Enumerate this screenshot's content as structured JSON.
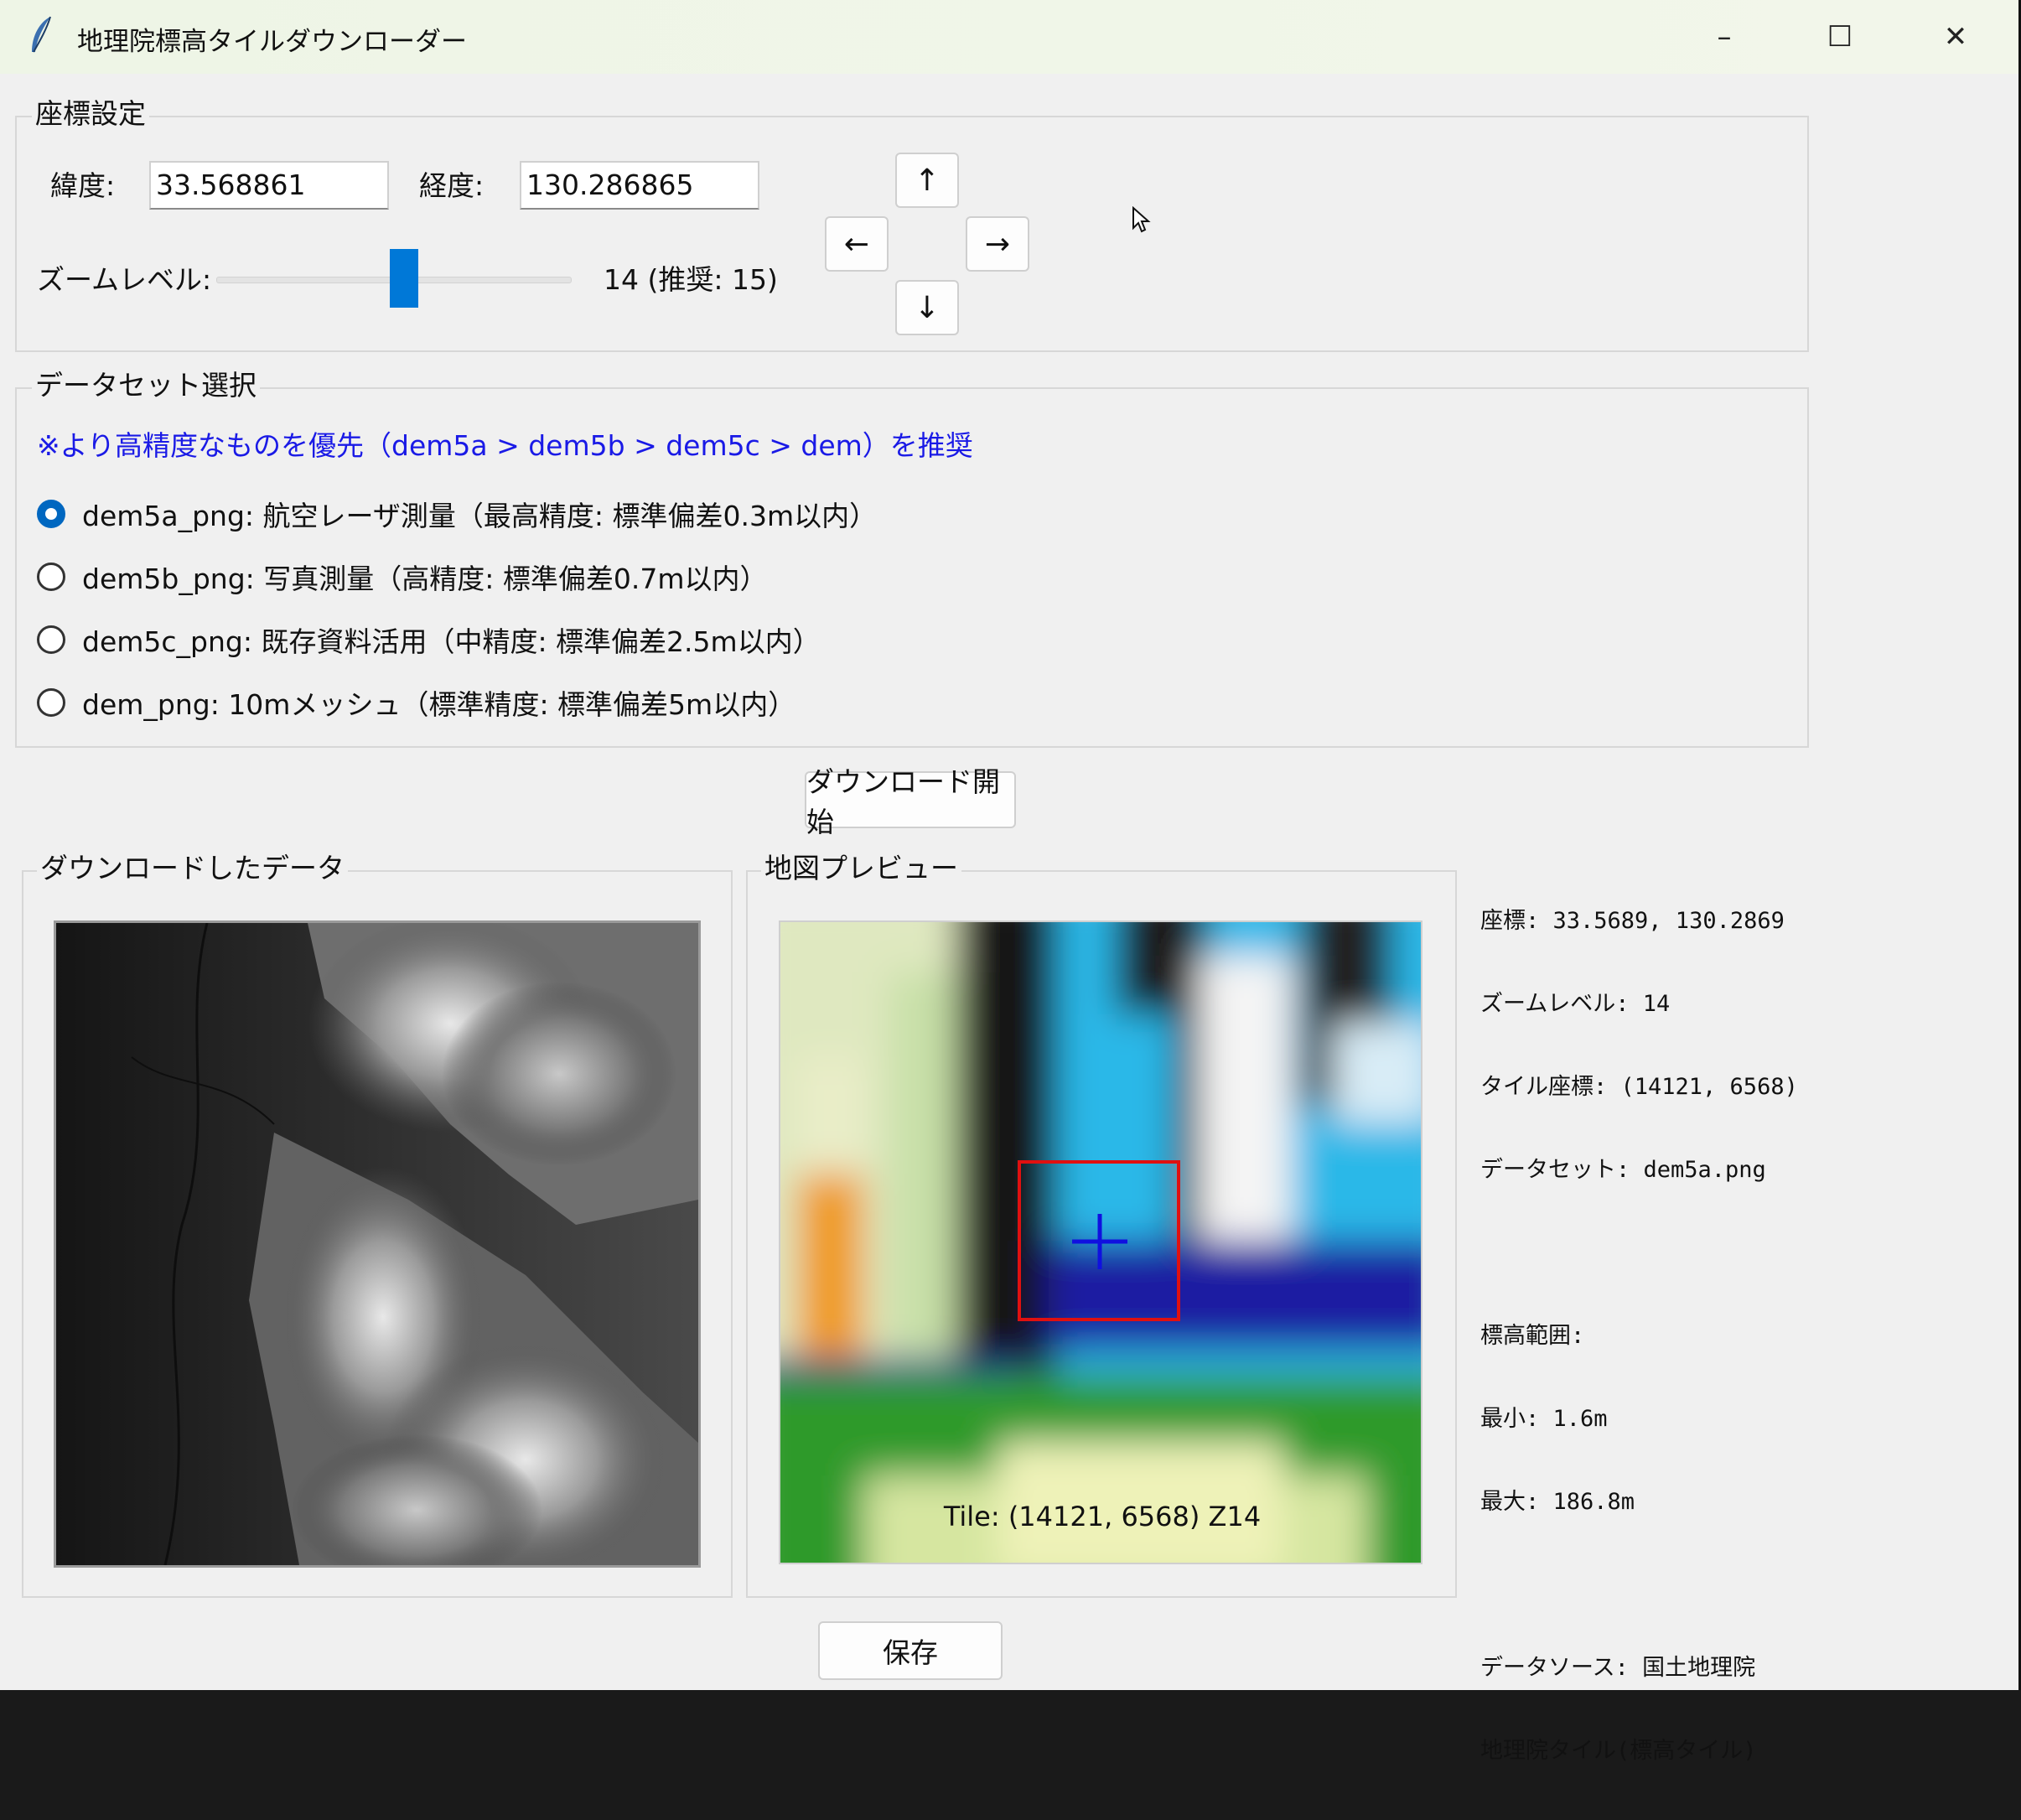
{
  "window": {
    "title": "地理院標高タイルダウンローダー",
    "controls": {
      "minimize": "–",
      "maximize": "☐",
      "close": "✕"
    }
  },
  "coords": {
    "group_label": "座標設定",
    "lat_label": "緯度:",
    "lat_value": "33.568861",
    "lon_label": "経度:",
    "lon_value": "130.286865",
    "zoom_label": "ズームレベル:",
    "zoom_value_text": "14 (推奨: 15)",
    "zoom_level": 14,
    "arrows": {
      "up": "↑",
      "left": "←",
      "right": "→",
      "down": "↓"
    }
  },
  "dataset": {
    "group_label": "データセット選択",
    "note": "※より高精度なものを優先（dem5a > dem5b > dem5c > dem）を推奨",
    "note_color": "#1a1ae6",
    "options": [
      {
        "label": "dem5a_png: 航空レーザ測量（最高精度: 標準偏差0.3m以内）",
        "selected": true
      },
      {
        "label": "dem5b_png: 写真測量（高精度: 標準偏差0.7m以内）",
        "selected": false
      },
      {
        "label": "dem5c_png: 既存資料活用（中精度: 標準偏差2.5m以内）",
        "selected": false
      },
      {
        "label": "dem_png: 10mメッシュ（標準精度: 標準偏差5m以内）",
        "selected": false
      }
    ]
  },
  "download_button": "ダウンロード開始",
  "downloaded": {
    "group_label": "ダウンロードしたデータ"
  },
  "preview": {
    "group_label": "地図プレビュー",
    "tile_caption": "Tile: (14121, 6568) Z14",
    "marker_color": "#e01010",
    "cross_color": "#1010e0"
  },
  "info": {
    "lines": [
      "座標: 33.5689, 130.2869",
      "ズームレベル: 14",
      "タイル座標: (14121, 6568)",
      "データセット: dem5a.png",
      "",
      "標高範囲:",
      "最小: 1.6m",
      "最大: 186.8m",
      "",
      "データソース: 国土地理院",
      "地理院タイル(標高タイル)"
    ]
  },
  "save_button": "保存"
}
